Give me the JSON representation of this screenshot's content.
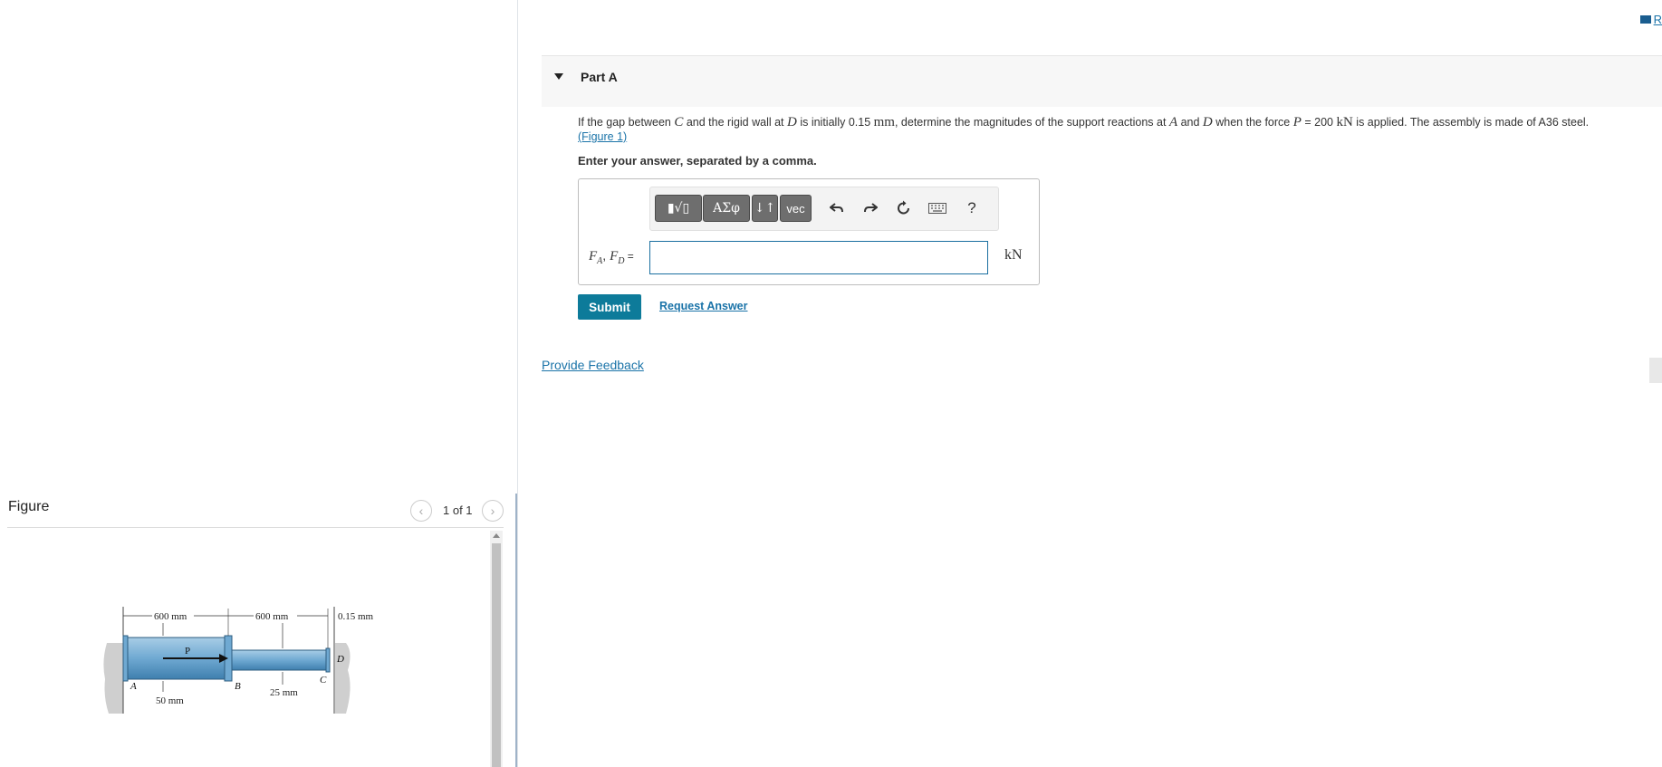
{
  "top_right": {
    "link_text": "R"
  },
  "part_a": {
    "title": "Part A",
    "question": {
      "t1": "If the gap between ",
      "c": "C",
      "t2": " and the rigid wall at ",
      "d": "D",
      "t3": " is initially 0.15 ",
      "mm": "mm",
      "t4": ", determine the magnitudes of the support reactions at ",
      "a": "A",
      "t5": " and ",
      "d2": "D",
      "t6": " when the force ",
      "p": "P",
      "t7": " = 200 ",
      "kn": "kN",
      "t8": " is applied. The assembly is made of A36 steel.",
      "figure_link": "(Figure 1)"
    },
    "instruction": "Enter your answer, separated by a comma.",
    "toolbar": {
      "templates": "▮√▯",
      "greek": "ΑΣφ",
      "arrows": "↓↑",
      "vec": "vec",
      "undo_icon": "undo-icon",
      "redo_icon": "redo-icon",
      "reset_icon": "reset-icon",
      "keyboard_icon": "keyboard-icon",
      "help": "?"
    },
    "answer_label": "F_A, F_D =",
    "answer_label_fa": "F",
    "answer_label_fa_sub": "A",
    "answer_label_sep": ", ",
    "answer_label_fd": "F",
    "answer_label_fd_sub": "D",
    "answer_label_eq": " =",
    "answer_value": "",
    "unit": "kN",
    "submit": "Submit",
    "request_answer": "Request Answer"
  },
  "provide_feedback": "Provide Feedback",
  "figure_panel": {
    "title": "Figure",
    "page_count": "1 of 1",
    "diagram_labels": {
      "dim1": "600 mm",
      "dim2": "600 mm",
      "gap": "0.15 mm",
      "p": "P",
      "a": "A",
      "b": "B",
      "c": "C",
      "d": "D",
      "dia1": "50 mm",
      "dia2": "25 mm"
    }
  },
  "colors": {
    "accent": "#0d7b9a",
    "link": "#1a73a8",
    "input_border": "#1a6fa0",
    "tool_button": "#6e6e6e"
  }
}
